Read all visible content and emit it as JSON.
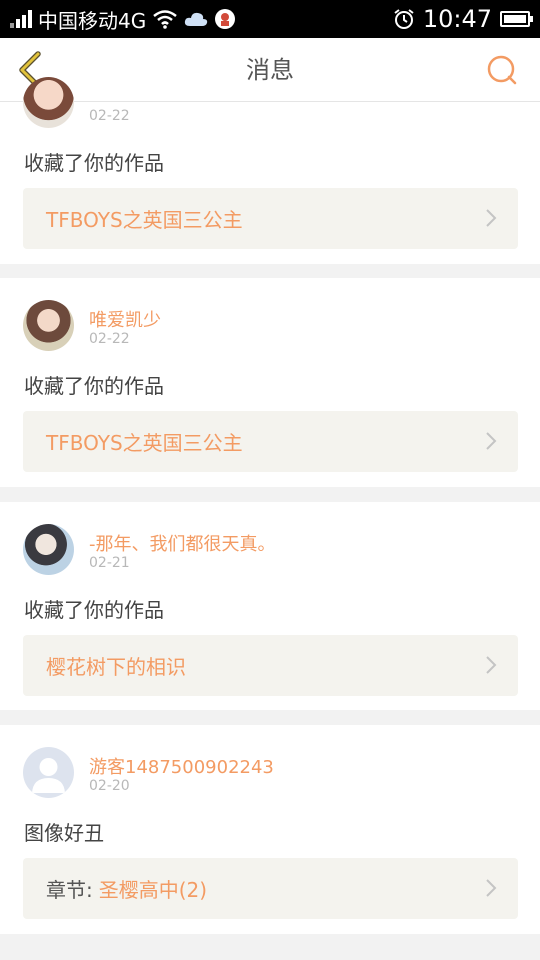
{
  "status_bar": {
    "carrier": "中国移动4G",
    "time": "10:47"
  },
  "header": {
    "title": "消息"
  },
  "colors": {
    "accent": "#f39b63",
    "back_arrow": "#e2c33b",
    "work_bg": "#f4f3ee"
  },
  "messages": [
    {
      "user": "",
      "date": "02-22",
      "text": "收藏了你的作品",
      "work_prefix": "",
      "work_title": "TFBOYS之英国三公主"
    },
    {
      "user": "唯爱凯少",
      "date": "02-22",
      "text": "收藏了你的作品",
      "work_prefix": "",
      "work_title": "TFBOYS之英国三公主"
    },
    {
      "user": "-那年、我们都很天真。",
      "date": "02-21",
      "text": "收藏了你的作品",
      "work_prefix": "",
      "work_title": "樱花树下的相识"
    },
    {
      "user": "游客1487500902243",
      "date": "02-20",
      "text": "图像好丑",
      "work_prefix": "章节:",
      "work_title": "圣樱高中(2)"
    }
  ]
}
